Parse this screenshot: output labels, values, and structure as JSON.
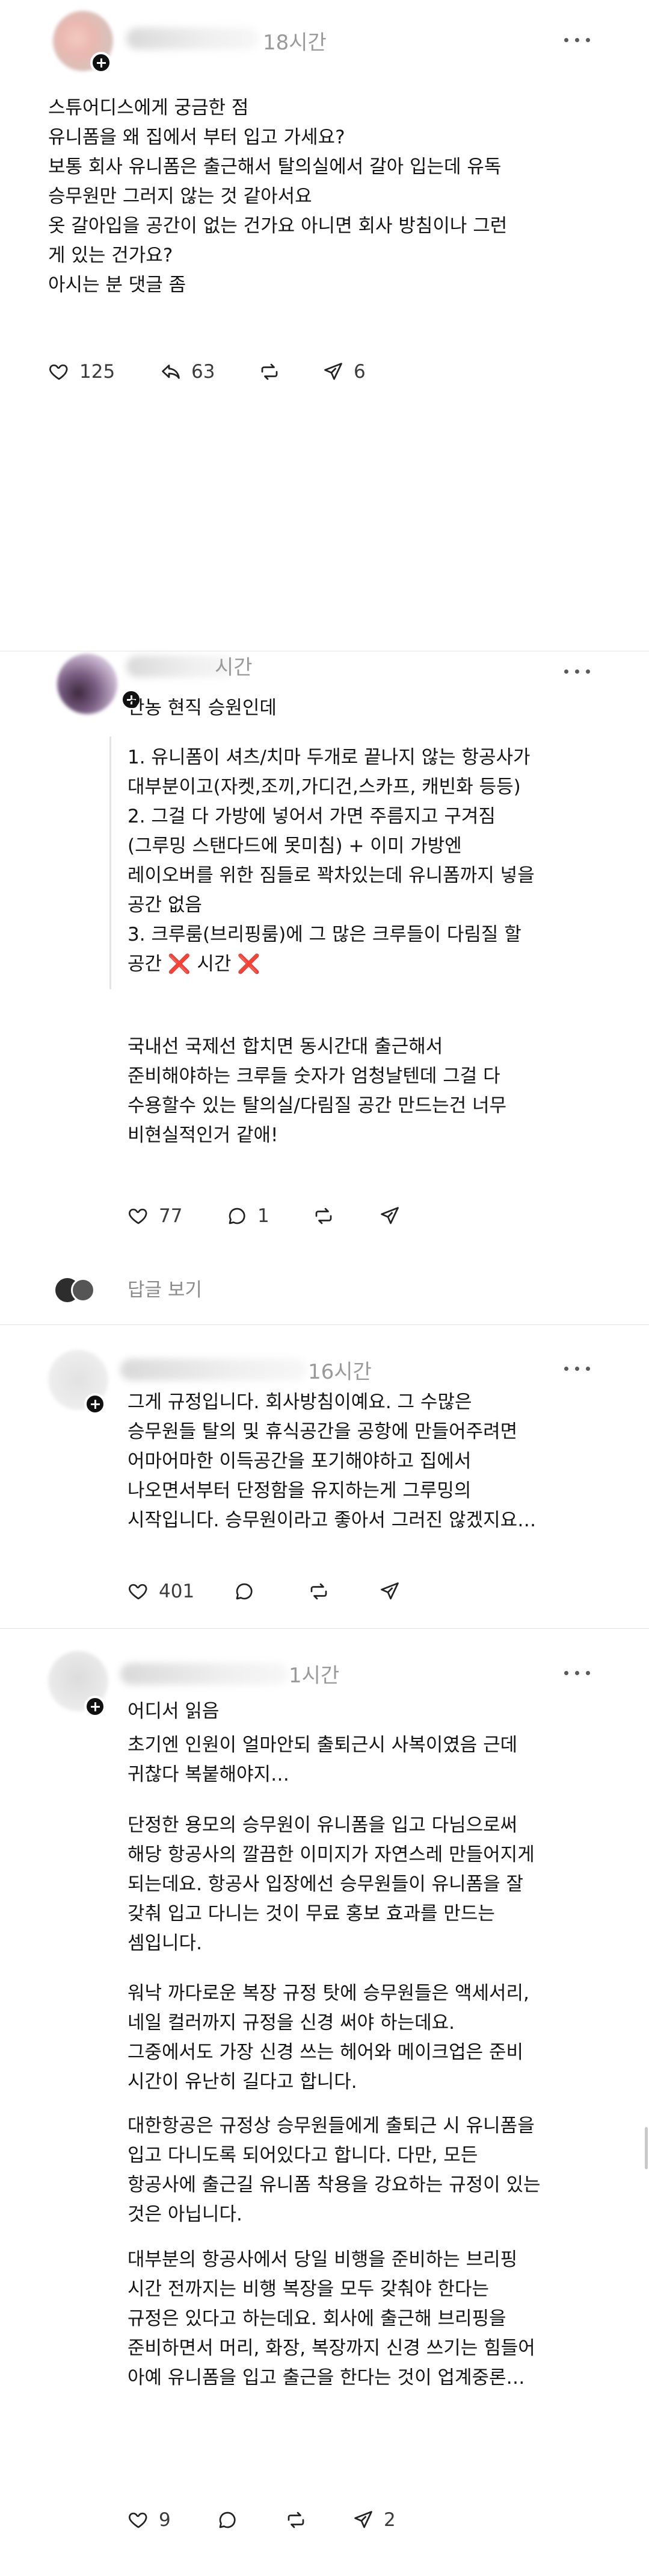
{
  "post1": {
    "time": "18시간",
    "lines": [
      "스튜어디스에게 궁금한 점",
      "유니폼을 왜 집에서 부터 입고 가세요?",
      "보통 회사 유니폼은 출근해서 탈의실에서 갈아 입는데 유독",
      "승무원만 그러지 않는 것 같아서요",
      "옷 갈아입을 공간이 없는 건가요 아니면 회사 방침이나 그런",
      "게 있는 건가요?",
      "아시는 분 댓글 좀"
    ],
    "likes": "125",
    "reposts": "63",
    "shares": "6"
  },
  "reply1": {
    "time": "시간",
    "intro": "안농 현직 승원인데",
    "quote_lines": [
      "1. 유니폼이 셔츠/치마 두개로 끝나지 않는 항공사가",
      "대부분이고(자켓,조끼,가디건,스카프, 캐빈화 등등)",
      "2. 그걸 다 가방에 넣어서 가면 주름지고 구겨짐",
      "(그루밍 스탠다드에 못미침) + 이미 가방엔",
      "레이오버를 위한 짐들로 꽉차있는데 유니폼까지 넣을",
      "공간 없음",
      "3. 크루룸(브리핑룸)에 그 많은 크루들이 다림질 할"
    ],
    "quote_last_prefix": "공간",
    "quote_last_mid": "시간",
    "x_mark": "❌",
    "body_lines": [
      "국내선 국제선 합치면 동시간대 출근해서",
      "준비해야하는 크루들 숫자가 엄청날텐데 그걸 다",
      "수용할수 있는 탈의실/다림질 공간 만드는건 너무",
      "비현실적인거 같애!"
    ],
    "likes": "77",
    "comments": "1",
    "view_replies": "답글 보기"
  },
  "reply2": {
    "time": "16시간",
    "lines": [
      "그게 규정입니다. 회사방침이예요. 그 수많은",
      "승무원들 탈의 및 휴식공간을 공항에 만들어주려면",
      "어마어마한 이득공간을 포기해야하고 집에서",
      "나오면서부터 단정함을 유지하는게 그루밍의",
      "시작입니다. 승무원이라고 좋아서 그러진 않겠지요…"
    ],
    "likes": "401"
  },
  "reply3": {
    "time": "1시간",
    "intro": "어디서 읽음",
    "p1": [
      "초기엔 인원이 얼마안되 출퇴근시 사복이였음 근데",
      "귀찮다 복붙해야지…"
    ],
    "p2": [
      "단정한 용모의 승무원이 유니폼을 입고 다님으로써",
      "해당 항공사의 깔끔한 이미지가 자연스레 만들어지게",
      "되는데요. 항공사 입장에선 승무원들이 유니폼을 잘",
      "갖춰 입고 다니는 것이 무료 홍보 효과를 만드는",
      "셈입니다."
    ],
    "p3": [
      "워낙 까다로운 복장 규정 탓에 승무원들은 액세서리,",
      "네일 컬러까지 규정을 신경 써야 하는데요.",
      "그중에서도 가장 신경 쓰는 헤어와 메이크업은 준비",
      "시간이 유난히 길다고 합니다."
    ],
    "p4": [
      "대한항공은 규정상 승무원들에게 출퇴근 시 유니폼을",
      "입고 다니도록 되어있다고 합니다. 다만, 모든",
      "항공사에 출근길 유니폼 착용을 강요하는 규정이 있는",
      "것은 아닙니다."
    ],
    "p5": [
      "대부분의 항공사에서 당일 비행을 준비하는 브리핑",
      "시간 전까지는 비행 복장을 모두 갖춰야 한다는",
      "규정은 있다고 하는데요. 회사에 출근해 브리핑을",
      "준비하면서 머리, 화장, 복장까지 신경 쓰기는 힘들어",
      "아예 유니폼을 입고 출근을 한다는 것이 업계중론…"
    ],
    "likes": "9",
    "shares": "2"
  },
  "colors": {
    "text": "#141414",
    "muted": "#9a9a9a",
    "divider": "#e3e3e3",
    "x_mark": "#d9261c"
  }
}
